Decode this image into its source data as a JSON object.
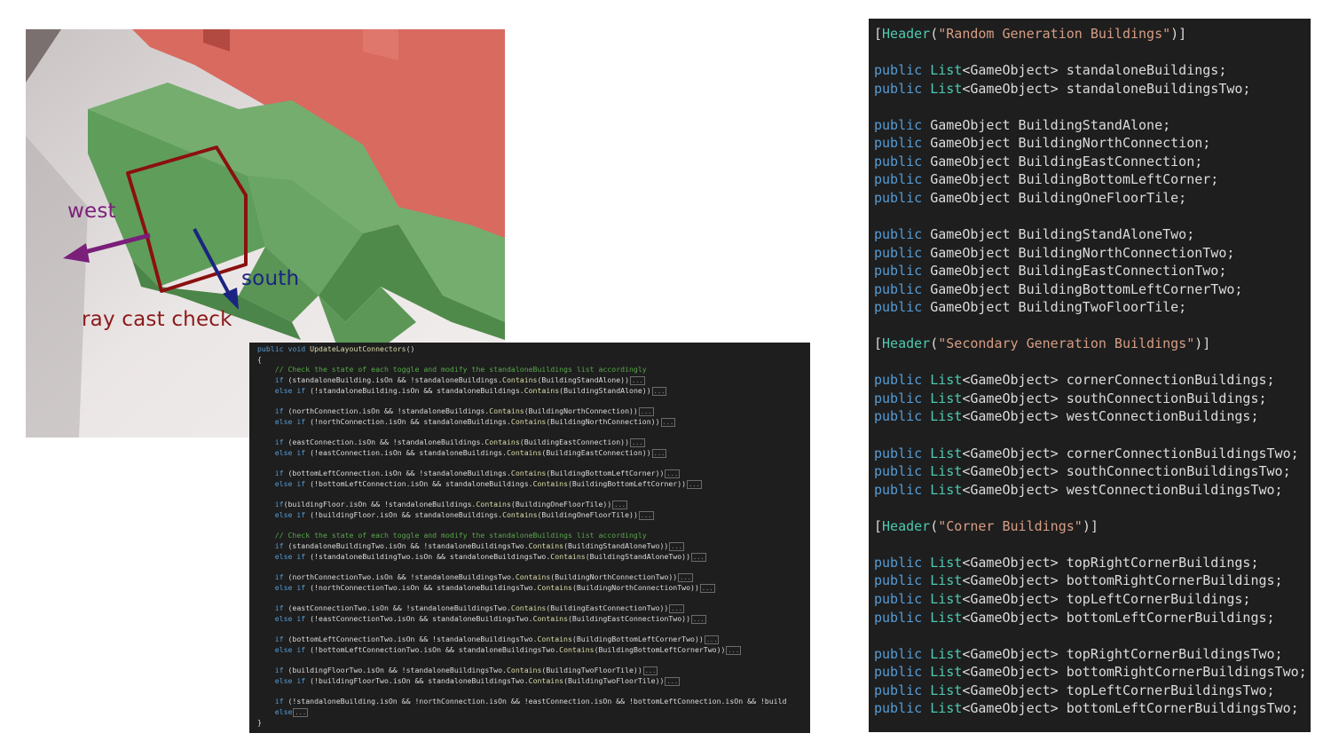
{
  "scene": {
    "labels": {
      "west": "west",
      "south": "south",
      "raycast": "ray cast check"
    },
    "colors": {
      "ground": "#e7e2e2",
      "green": "#6aa566",
      "red": "#d96a60",
      "west_arrow": "#7a1f7a",
      "south_arrow": "#1a2480",
      "raycast_box": "#8b1010",
      "raycast_text": "#8b1a1a"
    }
  },
  "code_mid": {
    "signature": "public void UpdateLayoutConnectors()",
    "open_brace": "{",
    "close_brace": "}",
    "comment": "// Check the state of each toggle and modify the standaloneBuildings list accordingly",
    "blocks": [
      [
        "if (standaloneBuilding.isOn && !standaloneBuildings.Contains(BuildingStandAlone))",
        "else if (!standaloneBuilding.isOn && standaloneBuildings.Contains(BuildingStandAlone))"
      ],
      [
        "if (northConnection.isOn && !standaloneBuildings.Contains(BuildingNorthConnection))",
        "else if (!northConnection.isOn && standaloneBuildings.Contains(BuildingNorthConnection))"
      ],
      [
        "if (eastConnection.isOn && !standaloneBuildings.Contains(BuildingEastConnection))",
        "else if (!eastConnection.isOn && standaloneBuildings.Contains(BuildingEastConnection))"
      ],
      [
        "if (bottomLeftConnection.isOn && !standaloneBuildings.Contains(BuildingBottomLeftCorner))",
        "else if (!bottomLeftConnection.isOn && standaloneBuildings.Contains(BuildingBottomLeftCorner))"
      ],
      [
        "if(buildingFloor.isOn && !standaloneBuildings.Contains(BuildingOneFloorTile))",
        "else if (!buildingFloor.isOn && standaloneBuildings.Contains(BuildingOneFloorTile))"
      ]
    ],
    "blocks_two": [
      [
        "if (standaloneBuildingTwo.isOn && !standaloneBuildingsTwo.Contains(BuildingStandAloneTwo))",
        "else if (!standaloneBuildingTwo.isOn && standaloneBuildingsTwo.Contains(BuildingStandAloneTwo))"
      ],
      [
        "if (northConnectionTwo.isOn && !standaloneBuildingsTwo.Contains(BuildingNorthConnectionTwo))",
        "else if (!northConnectionTwo.isOn && standaloneBuildingsTwo.Contains(BuildingNorthConnectionTwo))"
      ],
      [
        "if (eastConnectionTwo.isOn && !standaloneBuildingsTwo.Contains(BuildingEastConnectionTwo))",
        "else if (!eastConnectionTwo.isOn && standaloneBuildingsTwo.Contains(BuildingEastConnectionTwo))"
      ],
      [
        "if (bottomLeftConnectionTwo.isOn && !standaloneBuildingsTwo.Contains(BuildingBottomLeftCornerTwo))",
        "else if (!bottomLeftConnectionTwo.isOn && standaloneBuildingsTwo.Contains(BuildingBottomLeftCornerTwo))"
      ],
      [
        "if (buildingFloorTwo.isOn && !standaloneBuildingsTwo.Contains(BuildingTwoFloorTile))",
        "else if (!buildingFloorTwo.isOn && standaloneBuildingsTwo.Contains(BuildingTwoFloorTile))"
      ]
    ],
    "final": [
      "if (!standaloneBuilding.isOn && !northConnection.isOn && !eastConnection.isOn && !bottomLeftConnection.isOn && !build",
      "else"
    ],
    "collapsed": "..."
  },
  "code_right": {
    "lines": [
      "[Header(\"Random Generation Buildings\")]",
      "",
      "public List<GameObject> standaloneBuildings;",
      "public List<GameObject> standaloneBuildingsTwo;",
      "",
      "public GameObject BuildingStandAlone;",
      "public GameObject BuildingNorthConnection;",
      "public GameObject BuildingEastConnection;",
      "public GameObject BuildingBottomLeftCorner;",
      "public GameObject BuildingOneFloorTile;",
      "",
      "public GameObject BuildingStandAloneTwo;",
      "public GameObject BuildingNorthConnectionTwo;",
      "public GameObject BuildingEastConnectionTwo;",
      "public GameObject BuildingBottomLeftCornerTwo;",
      "public GameObject BuildingTwoFloorTile;",
      "",
      "[Header(\"Secondary Generation Buildings\")]",
      "",
      "public List<GameObject> cornerConnectionBuildings;",
      "public List<GameObject> southConnectionBuildings;",
      "public List<GameObject> westConnectionBuildings;",
      "",
      "public List<GameObject> cornerConnectionBuildingsTwo;",
      "public List<GameObject> southConnectionBuildingsTwo;",
      "public List<GameObject> westConnectionBuildingsTwo;",
      "",
      "[Header(\"Corner Buildings\")]",
      "",
      "public List<GameObject> topRightCornerBuildings;",
      "public List<GameObject> bottomRightCornerBuildings;",
      "public List<GameObject> topLeftCornerBuildings;",
      "public List<GameObject> bottomLeftCornerBuildings;",
      "",
      "public List<GameObject> topRightCornerBuildingsTwo;",
      "public List<GameObject> bottomRightCornerBuildingsTwo;",
      "public List<GameObject> topLeftCornerBuildingsTwo;",
      "public List<GameObject> bottomLeftCornerBuildingsTwo;"
    ]
  }
}
